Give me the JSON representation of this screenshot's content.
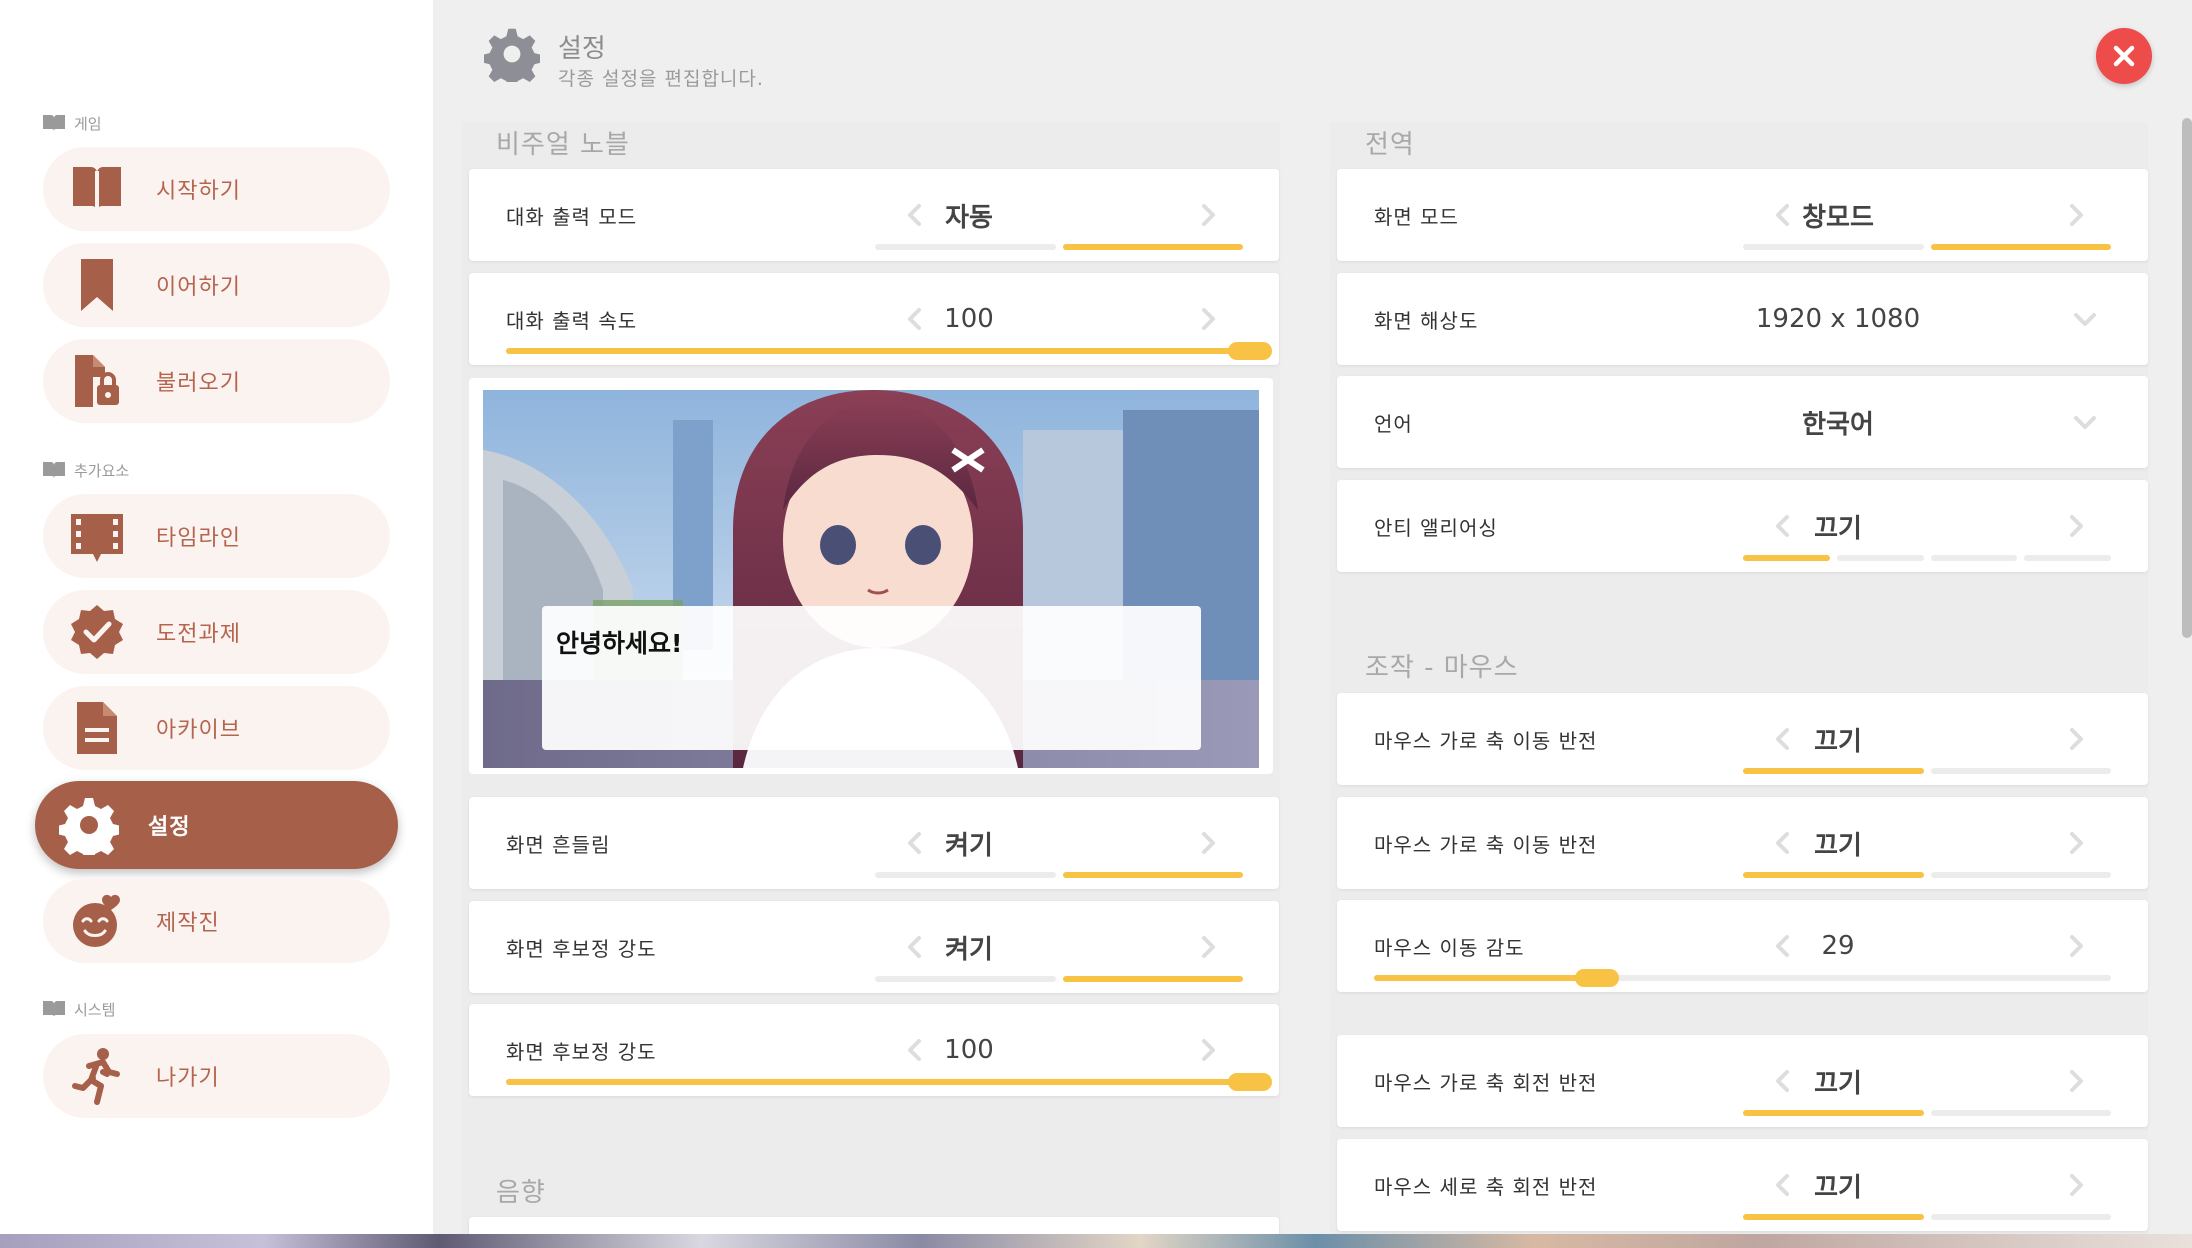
{
  "header": {
    "title": "설정",
    "subtitle": "각종 설정을 편집합니다.",
    "icon": "gear-icon"
  },
  "sidebar": {
    "sections": [
      {
        "label": "게임",
        "icon": "book-icon"
      },
      {
        "label": "추가요소",
        "icon": "book-icon"
      },
      {
        "label": "시스템",
        "icon": "book-icon"
      }
    ],
    "items": [
      {
        "label": "시작하기",
        "icon": "book-icon",
        "active": false
      },
      {
        "label": "이어하기",
        "icon": "bookmark-icon",
        "active": false
      },
      {
        "label": "불러오기",
        "icon": "file-lock-icon",
        "active": false
      },
      {
        "label": "타임라인",
        "icon": "film-strip-icon",
        "active": false
      },
      {
        "label": "도전과제",
        "icon": "badge-check-icon",
        "active": false
      },
      {
        "label": "아카이브",
        "icon": "document-icon",
        "active": false
      },
      {
        "label": "설정",
        "icon": "gear-icon",
        "active": true
      },
      {
        "label": "제작진",
        "icon": "heart-face-icon",
        "active": false
      },
      {
        "label": "나가기",
        "icon": "running-person-icon",
        "active": false
      }
    ]
  },
  "groups": {
    "visual_novel": "비주얼 노블",
    "global": "전역",
    "mouse": "조작 - 마우스",
    "sound": "음향"
  },
  "settings_left": [
    {
      "label": "대화 출력 모드",
      "value": "자동",
      "segments": 2,
      "selected": 2
    },
    {
      "label": "대화 출력 속도",
      "value": "100",
      "slider": 1.0
    },
    {
      "label": "화면 흔들림",
      "value": "켜기",
      "segments": 2,
      "selected": 2
    },
    {
      "label": "화면 후보정 강도",
      "value": "켜기",
      "segments": 2,
      "selected": 2
    },
    {
      "label": "화면 후보정 강도",
      "value": "100",
      "slider": 1.0
    }
  ],
  "preview": {
    "dialog_text": "안녕하세요!"
  },
  "settings_right": [
    {
      "label": "화면 모드",
      "value": "창모드",
      "segments": 2,
      "selected": 2
    },
    {
      "label": "화면 해상도",
      "value": "1920 x 1080",
      "dropdown": true
    },
    {
      "label": "언어",
      "value": "한국어",
      "dropdown": true
    },
    {
      "label": "안티 앨리어싱",
      "value": "끄기",
      "segments": 4,
      "selected": 1
    },
    {
      "label": "마우스 가로 축 이동 반전",
      "value": "끄기",
      "segments": 2,
      "selected": 1
    },
    {
      "label": "마우스 가로 축 이동 반전",
      "value": "끄기",
      "segments": 2,
      "selected": 1
    },
    {
      "label": "마우스 이동 감도",
      "value": "29",
      "slider": 0.29
    },
    {
      "label": "마우스 가로 축 회전 반전",
      "value": "끄기",
      "segments": 2,
      "selected": 1
    },
    {
      "label": "마우스 세로 축 회전 반전",
      "value": "끄기",
      "segments": 2,
      "selected": 1
    }
  ],
  "colors": {
    "accent": "#a65f48",
    "accent_text": "#b5644e",
    "nav_bg": "#fbf3ef",
    "bar_on": "#f8c244",
    "bar_off": "#ececec",
    "close": "#ee4b4b"
  }
}
